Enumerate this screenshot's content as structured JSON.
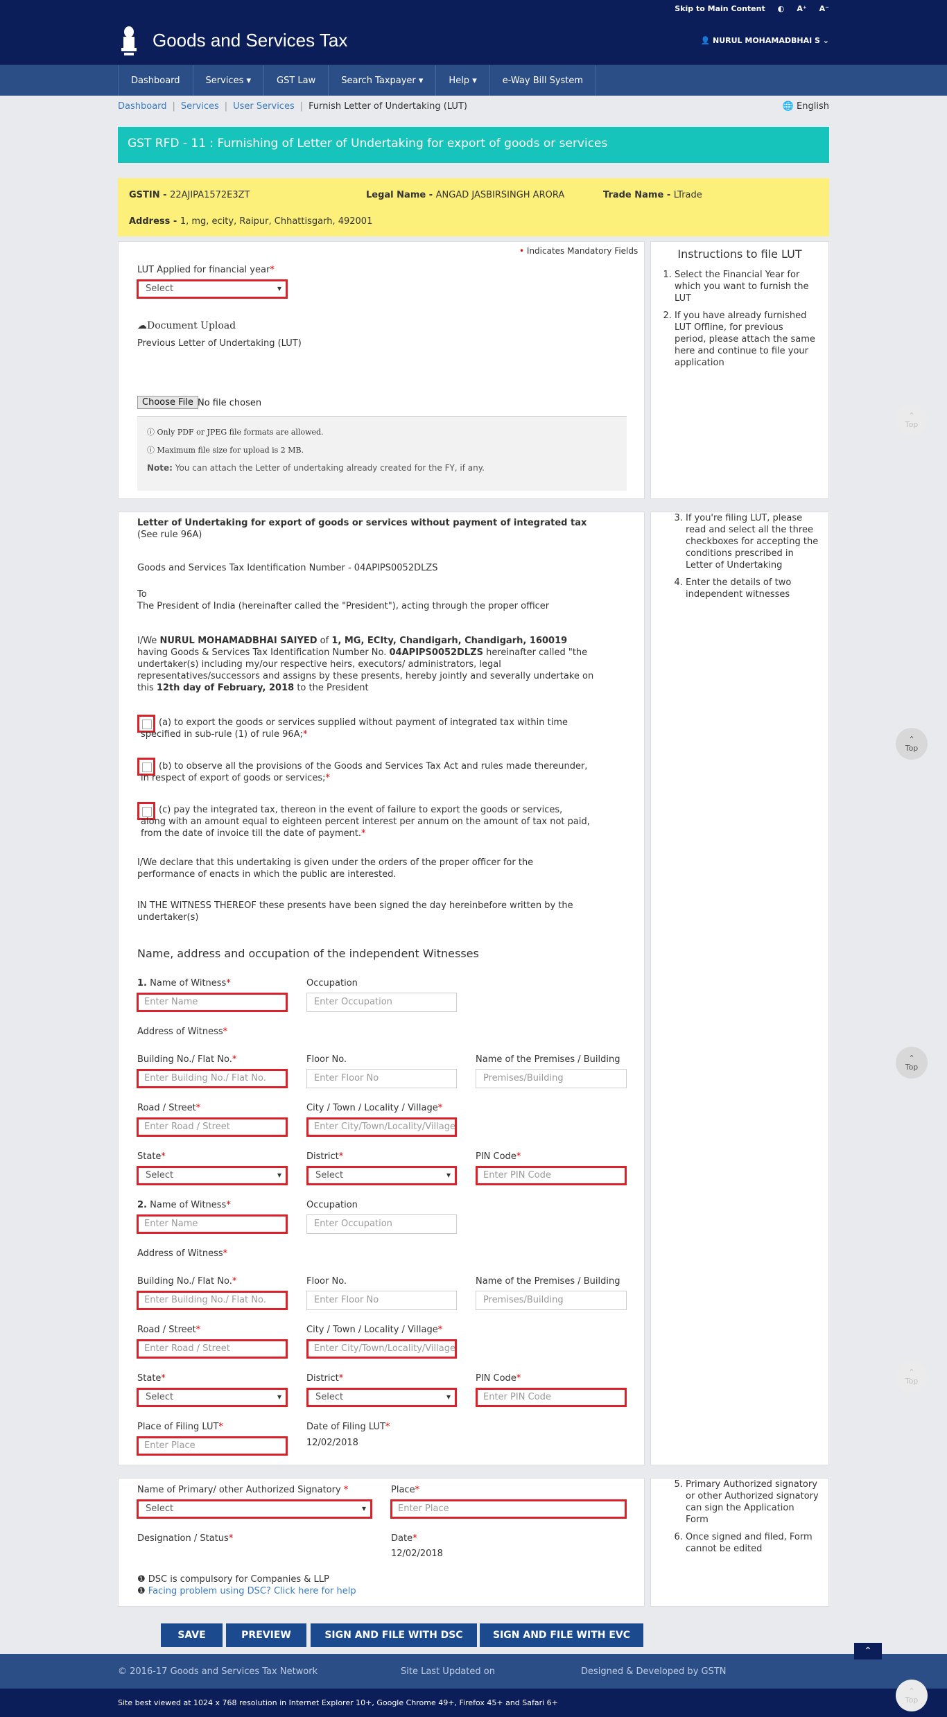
{
  "topbar": {
    "skip": "Skip to Main Content",
    "contrast": "◐",
    "font_up": "A⁺",
    "font_down": "A⁻"
  },
  "header": {
    "title": "Goods and Services Tax",
    "user": "👤 NURUL MOHAMADBHAI S ⌄"
  },
  "nav": [
    "Dashboard",
    "Services ▾",
    "GST Law",
    "Search Taxpayer ▾",
    "Help ▾",
    "e-Way Bill System"
  ],
  "breadcrumb": [
    "Dashboard",
    "Services",
    "User Services",
    "Furnish Letter of Undertaking (LUT)"
  ],
  "language": "🌐 English",
  "banner": "GST RFD - 11 : Furnishing of Letter of Undertaking for export of goods or services",
  "taxpayer": {
    "gstin_label": "GSTIN - ",
    "gstin": "22AJIPA1572E3ZT",
    "legal_label": "Legal Name - ",
    "legal": "ANGAD JASBIRSINGH ARORA",
    "trade_label": "Trade Name - ",
    "trade": "LTrade",
    "address_label": "Address - ",
    "address": "1, mg, ecity, Raipur, Chhattisgarh, 492001"
  },
  "section1": {
    "mandatory": "Indicates Mandatory Fields",
    "fy_label": "LUT Applied for financial year",
    "fy_value": "Select",
    "upload_title": "Document Upload",
    "upload_sub": "Previous Letter of Undertaking (LUT)",
    "choose": "Choose File",
    "nofile": "No file chosen",
    "note1": "Only PDF or JPEG file formats are allowed.",
    "note2": "Maximum file size for upload is 2 MB.",
    "note3_label": "Note:",
    "note3": " You can attach the Letter of undertaking already created for the FY, if any."
  },
  "instructions1": {
    "title": "Instructions to file LUT",
    "items": [
      "Select the Financial Year for which you want to furnish the LUT",
      "If you have already furnished LUT Offline, for previous period, please attach the same here and continue to file your application"
    ]
  },
  "letter": {
    "title": "Letter of Undertaking for export of goods or services without payment of integrated tax",
    "rule": "(See rule 96A)",
    "gstin_line": "Goods and Services Tax Identification Number - 04APIPS0052DLZS",
    "to": "To",
    "president": "The President of India (hereinafter called the \"President\"), acting through the proper officer",
    "p_iwe": "I/We ",
    "p_name": "NURUL MOHAMADBHAI SAIYED",
    "p_of": " of ",
    "p_addr": "1, MG, ECIty, Chandigarh, Chandigarh, 160019",
    "p_l2a": "having Goods & Services Tax Identification Number No. ",
    "p_gstin": "04APIPS0052DLZS",
    "p_l2b": " hereinafter called \"the",
    "p_l3": "undertaker(s) including my/our respective heirs, executors/ administrators, legal",
    "p_l4": "representatives/successors and assigns by these presents, hereby jointly and severally undertake on",
    "p_l5a": "this ",
    "p_date": "12th day of February, 2018",
    "p_l5b": " to the President",
    "a1": "(a) to export the goods or services supplied without payment of integrated tax within time",
    "a2": "specified in sub-rule (1) of rule 96A;",
    "b1": "(b) to observe all the provisions of the Goods and Services Tax Act and rules made thereunder,",
    "b2": "in respect of export of goods or services;",
    "c1": "(c) pay the integrated tax, thereon in the event of failure to export the goods or services,",
    "c2": "along with an amount equal to eighteen percent interest per annum on the amount of tax not paid,",
    "c3": "from the date of invoice till the date of payment.",
    "d1": "I/We declare that this undertaking is given under the orders of the proper officer for the",
    "d2": "performance of enacts in which the public are interested.",
    "w1": "IN THE WITNESS THEREOF these presents have been signed the day hereinbefore written by the",
    "w2": "undertaker(s)"
  },
  "instructions2": {
    "items": [
      "If you're filing LUT, please read and select all the three checkboxes for accepting the conditions prescribed in Letter of Undertaking",
      "Enter the details of two independent witnesses"
    ]
  },
  "witness": {
    "heading": "Name, address and occupation of the independent Witnesses",
    "w1_num": "1.",
    "w2_num": "2.",
    "name_label": "Name of Witness",
    "name_ph": "Enter Name",
    "occ_label": "Occupation",
    "occ_ph": "Enter Occupation",
    "addr_label": "Address of Witness",
    "bldg_label": "Building No./ Flat No.",
    "bldg_ph": "Enter Building No./ Flat No.",
    "floor_label": "Floor No.",
    "floor_ph": "Enter Floor No",
    "prem_label": "Name of the Premises / Building",
    "prem_ph": "Premises/Building",
    "road_label": "Road / Street",
    "road_ph": "Enter Road / Street",
    "city_label": "City / Town / Locality / Village",
    "city_ph": "Enter City/Town/Locality/Village",
    "state_label": "State",
    "state_val": "Select",
    "district_label": "District",
    "district_val": "Select",
    "pin_label": "PIN Code",
    "pin_ph": "Enter PIN Code",
    "place_label": "Place of Filing LUT",
    "place_ph": "Enter Place",
    "date_label": "Date of Filing LUT",
    "date_val": "12/02/2018"
  },
  "signatory": {
    "name_label": "Name of Primary/ other Authorized Signatory",
    "name_val": "Select",
    "place_label": "Place",
    "place_ph": "Enter Place",
    "desig_label": "Designation / Status",
    "date_label": "Date",
    "date_val": "12/02/2018",
    "dsc1": "DSC is compulsory for Companies & LLP",
    "dsc2": "Facing problem using DSC? Click here for help"
  },
  "instructions3": {
    "items": [
      "Primary Authorized signatory or other Authorized signatory can sign the Application Form",
      "Once signed and filed, Form cannot be edited"
    ]
  },
  "buttons": {
    "save": "SAVE",
    "preview": "PREVIEW",
    "dsc": "SIGN AND FILE WITH DSC",
    "evc": "SIGN AND FILE WITH EVC"
  },
  "footer": {
    "copyright": "© 2016-17 Goods and Services Tax Network",
    "updated": "Site Last Updated on",
    "designed": "Designed & Developed by GSTN",
    "best": "Site best viewed at 1024 x 768 resolution in Internet Explorer 10+, Google Chrome 49+, Firefox 45+ and Safari 6+"
  },
  "totop": {
    "label": "Top",
    "arrow": "⌃"
  },
  "colors": {
    "navy": "#0b1e59",
    "nav": "#2c4e86",
    "teal": "#17c4bb",
    "yellow": "#fdf07a",
    "error": "#d9222a",
    "button": "#1c4a8f"
  }
}
